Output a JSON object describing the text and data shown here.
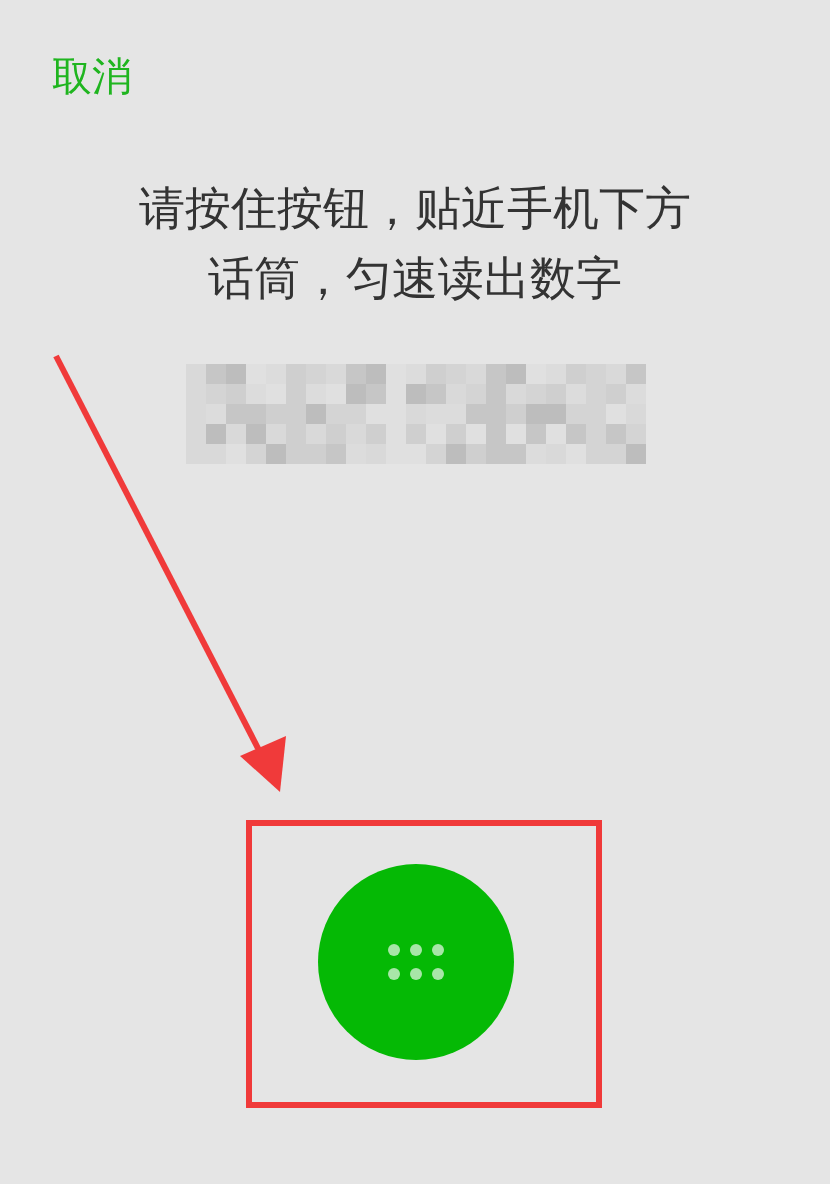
{
  "cancel": "取消",
  "instruction": "请按住按钮，贴近手机下方话筒，匀速读出数字"
}
